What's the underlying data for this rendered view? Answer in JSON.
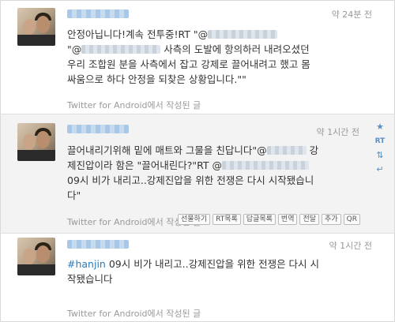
{
  "tweets": [
    {
      "time": "약 24분 전",
      "lines": [
        {
          "text": "안정아닙니다!계속 전투중!RT \"@"
        },
        {
          "text": "\"@",
          "after_blur": " 사측의 도발에 항의하러 내려오셨던"
        },
        {
          "text": "우리 조합원 분을 사측에서 잡고 강제로 끌어내려고 했고 몸"
        },
        {
          "text": "싸움으로 하다 안정을 되찾은 상황입니다.\"\""
        }
      ],
      "source": "Twitter for Android에서 작성된 글"
    },
    {
      "time": "약 1시간 전",
      "lines": [
        {
          "text": "끌어내리기위해 밑에 매트와 그물을 친답니다\"@",
          "after_blur": " 강"
        },
        {
          "text": "제진압이라 함은 \"끌어내린다?\"RT @"
        },
        {
          "text": "09시 비가 내리고..강제진압을 위한 전쟁은 다시 시작됐습니"
        },
        {
          "text": "다\""
        }
      ],
      "source": "Twitter for Android에서 작성된 글",
      "actions": {
        "favorite": "★",
        "rt": "RT",
        "retweet": "⇅",
        "reply": "↵"
      },
      "buttons": [
        "선물하기",
        "RT목록",
        "답글목록",
        "번역",
        "전달",
        "추가",
        "QR"
      ]
    },
    {
      "time": "약 1시간 전",
      "hashtag": "#hanjin",
      "lines": [
        {
          "text": " 09시 비가 내리고..강제진압을 위한 전쟁은 다시 시"
        },
        {
          "text": "작됐습니다"
        }
      ],
      "source": "Twitter for Android에서 작성된 글"
    }
  ]
}
